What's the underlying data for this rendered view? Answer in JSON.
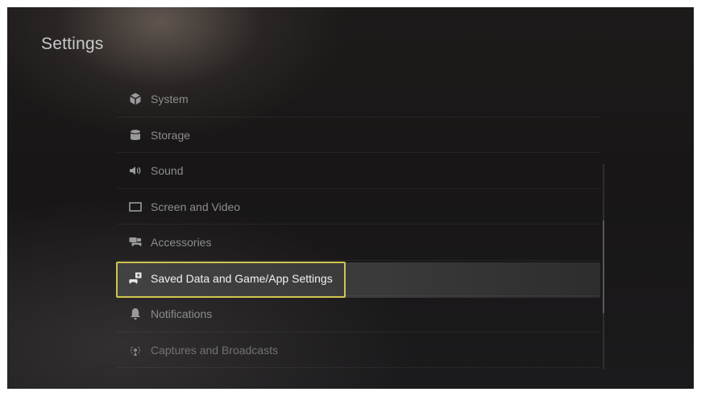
{
  "page": {
    "title": "Settings"
  },
  "menu": {
    "items": [
      {
        "label": "System",
        "icon": "system-icon"
      },
      {
        "label": "Storage",
        "icon": "storage-icon"
      },
      {
        "label": "Sound",
        "icon": "sound-icon"
      },
      {
        "label": "Screen and Video",
        "icon": "screen-icon"
      },
      {
        "label": "Accessories",
        "icon": "accessories-icon"
      },
      {
        "label": "Saved Data and Game/App Settings",
        "icon": "saved-data-icon",
        "selected": true
      },
      {
        "label": "Notifications",
        "icon": "bell-icon"
      },
      {
        "label": "Captures and Broadcasts",
        "icon": "captures-icon"
      }
    ]
  },
  "scroll": {
    "position": 0.5,
    "visible_fraction": 0.45
  },
  "colors": {
    "focus_border": "#cfc54d",
    "selected_row": "#424242",
    "item_text": "#8d8d8d",
    "selected_text": "#f2f2f2",
    "background": "#1b1818"
  }
}
